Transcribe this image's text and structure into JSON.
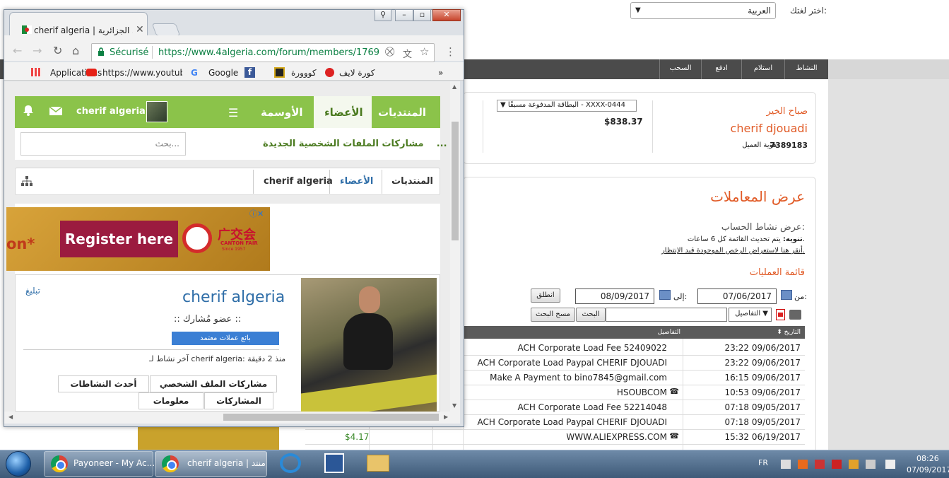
{
  "payoneer": {
    "lang_label": "اختر لغتك:",
    "lang_value": "العربية",
    "nav": [
      "النشاط",
      "استلام",
      "ادفع",
      "السحب"
    ],
    "greeting": "صباح الخير",
    "customer_name": "cherif djouadi",
    "customer_id_label": "هوية العميل",
    "customer_id": "7389183",
    "card_select": "البطاقة المدفوعة مسبقًا - XXXX-0444",
    "card_balance": "$838.37",
    "tx_title": "عرض المعاملات",
    "tx_sub": "عرض نشاط الحساب:",
    "tx_note_bold": "تنويه:",
    "tx_note": "يتم تحديث القائمة كل 6 ساعات.",
    "tx_link": "أنقر هنا لاستعراض الرخص الموجودة قيد الإنتظار.",
    "tx_list_title": "قائمة العمليات",
    "from_label": "من:",
    "from_date": "07/06/2017",
    "to_label": "إلى:",
    "to_date": "08/09/2017",
    "go_button": "انطلق",
    "details_select": "التفاصيل",
    "search_button": "البحث",
    "clear_button": "مسح البحث",
    "col_date": "التاريخ",
    "col_details": "التفاصيل",
    "rows": [
      {
        "date": "23:22 09/06/2017",
        "desc": "ACH Corporate Load Fee 52409022",
        "amount": "",
        "phone": ""
      },
      {
        "date": "23:22 09/06/2017",
        "desc": "ACH Corporate Load Paypal CHERIF DJOUADI",
        "amount": "",
        "phone": ""
      },
      {
        "date": "16:15 09/06/2017",
        "desc": "Make A Payment to bino7845@gmail.com",
        "amount": "",
        "phone": ""
      },
      {
        "date": "10:53 09/06/2017",
        "desc": "HSOUBCOM",
        "amount": "",
        "phone": "☎"
      },
      {
        "date": "07:18 09/05/2017",
        "desc": "ACH Corporate Load Fee 52214048",
        "amount": "",
        "phone": ""
      },
      {
        "date": "07:18 09/05/2017",
        "desc": "ACH Corporate Load Paypal CHERIF DJOUADI",
        "amount": "",
        "phone": ""
      },
      {
        "date": "15:32 06/19/2017",
        "desc": "WWW.ALIEXPRESS.COM",
        "amount": "$4.17",
        "phone": "☎"
      }
    ]
  },
  "chrome": {
    "tab_title": "cherif algeria | منتدى الجزائرية",
    "secure_label": "Sécurisé",
    "url": "https://www.4algeria.com/forum/members/1769...",
    "bookmarks": [
      "Applications",
      "https://www.youtube",
      "Google",
      "كووورة",
      "كورة لايف"
    ],
    "bookmarks_more": "»"
  },
  "forum": {
    "tab_forums": "المنتديات",
    "tab_members": "الأعضاء",
    "tab_badges": "الأوسمة",
    "user": "cherif algeria",
    "search_placeholder": "بحث...",
    "new_shares": "مشاركات الملفات الشخصية الجديدة",
    "new_shares_more": "...",
    "crumbs": [
      "المنتديات",
      "الأعضاء",
      "cherif algeria"
    ],
    "ad_left": "on*",
    "ad_button": "Register here",
    "ad_logo_text": "广交会",
    "ad_logo_sub": "CANTON FAIR",
    "ad_logo_since": "Since 1957",
    "profile_name": "cherif algeria",
    "profile_role": ":: عضو مُشارك ::",
    "profile_badge": "بائع عملات معتمد",
    "profile_report": "تبليغ",
    "profile_last": "آخر نشاط لـ cherif algeria: منذ 2 دقيقة",
    "profile_tabs": [
      "مشاركات الملف الشخصي",
      "أحدث النشاطات",
      "المشاركات",
      "معلومات"
    ]
  },
  "taskbar": {
    "items": [
      "Payoneer - My Ac...",
      "cherif algeria | منتد..."
    ],
    "lang": "FR",
    "time": "08:26",
    "date": "07/09/2017"
  },
  "colors": {
    "accent_orange": "#e15b27",
    "forum_green": "#8bc34a",
    "secure_green": "#0b8043"
  }
}
